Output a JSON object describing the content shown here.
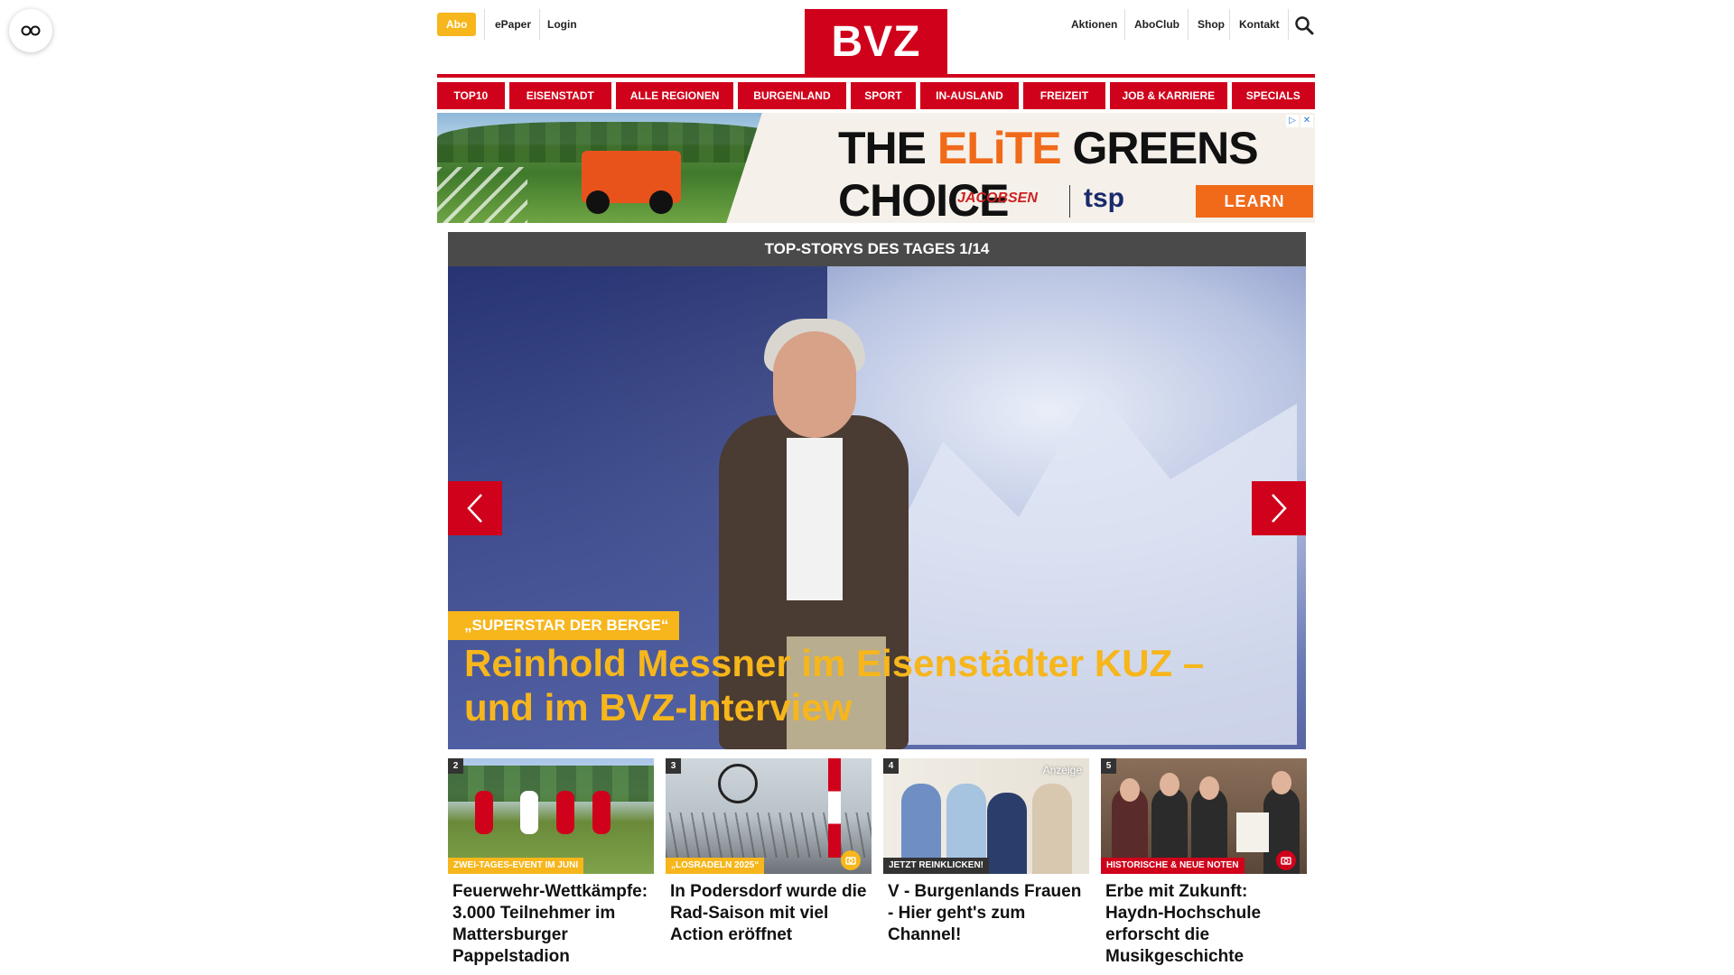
{
  "header": {
    "abo_label": "Abo",
    "epaper_label": "ePaper",
    "login_label": "Login",
    "logo_text": "BVZ",
    "right_links": [
      "Aktionen",
      "AboClub",
      "Shop",
      "Kontakt"
    ]
  },
  "nav": {
    "items": [
      "TOP10",
      "EISENSTADT",
      "ALLE REGIONEN",
      "BURGENLAND",
      "SPORT",
      "IN-AUSLAND",
      "FREIZEIT",
      "JOB & KARRIERE",
      "SPECIALS"
    ]
  },
  "ad": {
    "headline_pre": "THE ",
    "headline_accent": "ELiTE",
    "headline_post": " GREENS CHOICE",
    "brand1": "JACOBSEN",
    "brand2": "tsp",
    "cta": "LEARN MORE"
  },
  "slider": {
    "header": "TOP-STORYS DES TAGES 1/14",
    "kicker": "„SUPERSTAR DER BERGE“",
    "headline": "Reinhold Messner im Eisenstädter KUZ – und im BVZ-Interview"
  },
  "stories": [
    {
      "num": "2",
      "badge": "ZWEI-TAGES-EVENT IM JUNI",
      "title": "Feuerwehr-Wettkämpfe: 3.000 Teilnehmer im Mattersburger Pappelstadion"
    },
    {
      "num": "3",
      "badge": "„LOSRADELN 2025“",
      "title": "In Podersdorf wurde die Rad-Saison mit viel Action eröffnet"
    },
    {
      "num": "4",
      "badge": "JETZT REINKLICKEN!",
      "anzeige": "Anzeige",
      "title": "V - Burgenlands Frauen - Hier geht's zum Channel!"
    },
    {
      "num": "5",
      "badge": "HISTORISCHE & NEUE NOTEN",
      "title": "Erbe mit Zukunft: Haydn-Hochschule erforscht die Musikgeschichte"
    }
  ],
  "colors": {
    "brand_red": "#d0021b",
    "accent_yellow": "#f6b61c",
    "dark_gray": "#4a4a4a"
  }
}
